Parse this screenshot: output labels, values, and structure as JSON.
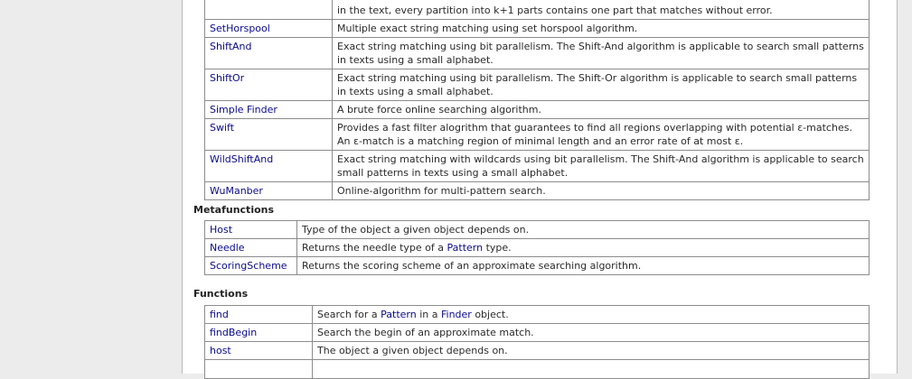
{
  "specializations": {
    "rows": [
      {
        "name": "",
        "desc": "in the text, every partition into k+1 parts contains one part that matches without error."
      },
      {
        "name": "SetHorspool",
        "desc": "Multiple exact string matching using set horspool algorithm."
      },
      {
        "name": "ShiftAnd",
        "desc": "Exact string matching using bit parallelism. The Shift-And algorithm is applicable to search small patterns in texts using a small alphabet."
      },
      {
        "name": "ShiftOr",
        "desc": "Exact string matching using bit parallelism. The Shift-Or algorithm is applicable to search small patterns in texts using a small alphabet."
      },
      {
        "name": "Simple Finder",
        "desc": "A brute force online searching algorithm."
      },
      {
        "name": "Swift",
        "desc": "Provides a fast filter alogrithm that guarantees to find all regions overlapping with potential ε-matches. An ε-match is a matching region of minimal length and an error rate of at most ε."
      },
      {
        "name": "WildShiftAnd",
        "desc": "Exact string matching with wildcards using bit parallelism. The Shift-And algorithm is applicable to search small patterns in texts using a small alphabet."
      },
      {
        "name": "WuManber",
        "desc": "Online-algorithm for multi-pattern search."
      }
    ]
  },
  "metafunctions": {
    "heading": "Metafunctions",
    "rows": [
      {
        "name": "Host",
        "pre": "Type of the object a given object depends on.",
        "link": "",
        "post": ""
      },
      {
        "name": "Needle",
        "pre": "Returns the needle type of a ",
        "link": "Pattern",
        "post": " type."
      },
      {
        "name": "ScoringScheme",
        "pre": "Returns the scoring scheme of an approximate searching algorithm.",
        "link": "",
        "post": ""
      }
    ]
  },
  "functions": {
    "heading": "Functions",
    "rows": [
      {
        "name": "find",
        "pre": "Search for a ",
        "link": "Pattern",
        "mid": " in a ",
        "link2": "Finder",
        "post": " object."
      },
      {
        "name": "findBegin",
        "pre": "Search the begin of an approximate match.",
        "link": "",
        "mid": "",
        "link2": "",
        "post": ""
      },
      {
        "name": "host",
        "pre": "The object a given object depends on.",
        "link": "",
        "mid": "",
        "link2": "",
        "post": ""
      },
      {
        "name": "",
        "pre": "",
        "link": "",
        "mid": "",
        "link2": "",
        "post": ""
      }
    ]
  }
}
